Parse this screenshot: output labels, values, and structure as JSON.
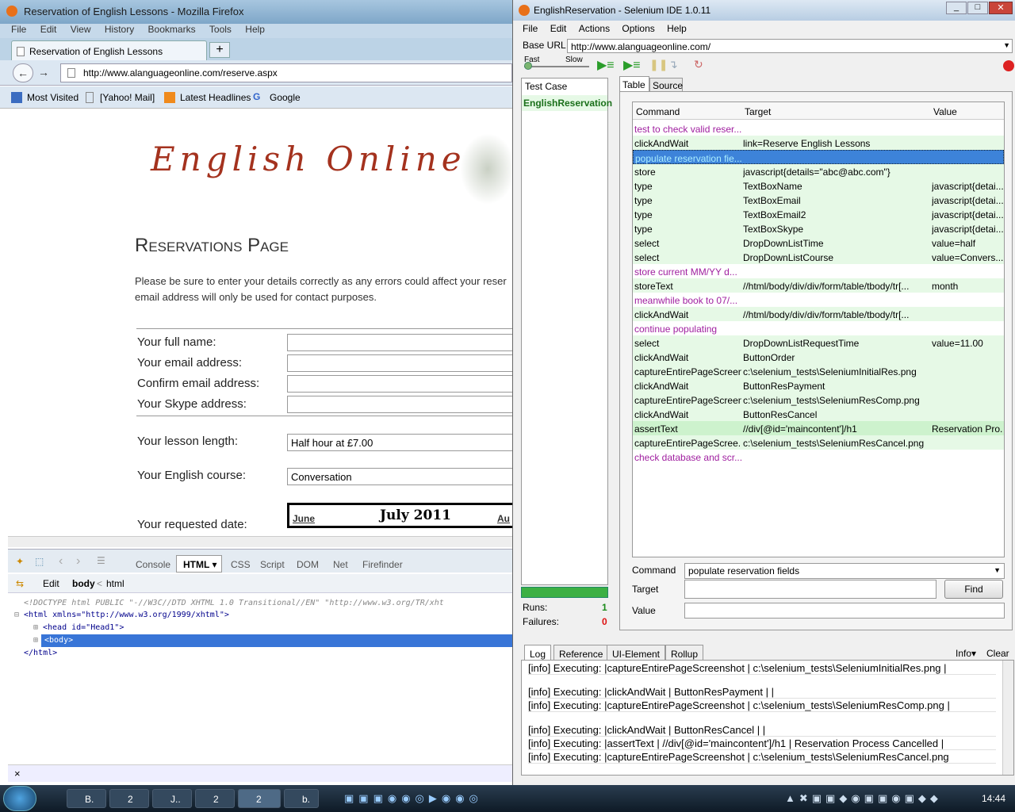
{
  "firefox": {
    "title": "Reservation of English Lessons - Mozilla Firefox",
    "menu": [
      "File",
      "Edit",
      "View",
      "History",
      "Bookmarks",
      "Tools",
      "Help"
    ],
    "tab": "Reservation of English Lessons",
    "url": "http://www.alanguageonline.com/reserve.aspx",
    "bookmarks": [
      "Most Visited",
      "[Yahoo! Mail]",
      "Latest Headlines",
      "Google"
    ],
    "page": {
      "logo": "English Online",
      "heading": "Reservations Page",
      "intro1": "Please be sure to enter your details correctly as any errors could affect your reser",
      "intro2": "email address will only be used for contact purposes.",
      "labels": [
        "Your full name:",
        "Your email address:",
        "Confirm email address:",
        "Your Skype address:",
        "Your lesson length:",
        "Your English course:",
        "Your requested date:"
      ],
      "lesson_length": "Half hour at £7.00",
      "course": "Conversation",
      "cal_prev": "June",
      "cal_month": "July 2011",
      "cal_next": "Au"
    },
    "firebug": {
      "tabs": [
        "Console",
        "HTML",
        "CSS",
        "Script",
        "DOM",
        "Net",
        "Firefinder"
      ],
      "edit": "Edit",
      "crumb_body": "body",
      "crumb_html": "html",
      "code": [
        "<!DOCTYPE html PUBLIC \"-//W3C//DTD XHTML 1.0 Transitional//EN\" \"http://www.w3.org/TR/xht",
        "<html xmlns=\"http://www.w3.org/1999/xhtml\">",
        "<head id=\"Head1\">",
        "<body>",
        "</html>"
      ]
    }
  },
  "selenium": {
    "title": "EnglishReservation - Selenium IDE 1.0.11",
    "menu": [
      "File",
      "Edit",
      "Actions",
      "Options",
      "Help"
    ],
    "base_url_label": "Base URL",
    "base_url": "http://www.alanguageonline.com/",
    "speed_fast": "Fast",
    "speed_slow": "Slow",
    "test_case_header": "Test Case",
    "test_case": "EnglishReservation",
    "tabs": [
      "Table",
      "Source"
    ],
    "columns": [
      "Command",
      "Target",
      "Value"
    ],
    "rows": [
      {
        "c": "test to check valid reser...",
        "t": "",
        "v": "",
        "kind": "comment"
      },
      {
        "c": "clickAndWait",
        "t": "link=Reserve English Lessons",
        "v": "",
        "kind": "green"
      },
      {
        "c": "populate reservation fie...",
        "t": "",
        "v": "",
        "kind": "selected"
      },
      {
        "c": "store",
        "t": "javascript{details=\"abc@abc.com\"}",
        "v": "",
        "kind": "green"
      },
      {
        "c": "type",
        "t": "TextBoxName",
        "v": "javascript{detai...",
        "kind": "green"
      },
      {
        "c": "type",
        "t": "TextBoxEmail",
        "v": "javascript{detai...",
        "kind": "green"
      },
      {
        "c": "type",
        "t": "TextBoxEmail2",
        "v": "javascript{detai...",
        "kind": "green"
      },
      {
        "c": "type",
        "t": "TextBoxSkype",
        "v": "javascript{detai...",
        "kind": "green"
      },
      {
        "c": "select",
        "t": "DropDownListTime",
        "v": "value=half",
        "kind": "green"
      },
      {
        "c": "select",
        "t": "DropDownListCourse",
        "v": "value=Convers...",
        "kind": "green"
      },
      {
        "c": "store current MM/YY d...",
        "t": "",
        "v": "",
        "kind": "comment"
      },
      {
        "c": "storeText",
        "t": "//html/body/div/div/form/table/tbody/tr[...",
        "v": "month",
        "kind": "green"
      },
      {
        "c": "meanwhile book to 07/...",
        "t": "",
        "v": "",
        "kind": "comment"
      },
      {
        "c": "clickAndWait",
        "t": "//html/body/div/div/form/table/tbody/tr[...",
        "v": "",
        "kind": "green"
      },
      {
        "c": "continue populating",
        "t": "",
        "v": "",
        "kind": "comment"
      },
      {
        "c": "select",
        "t": "DropDownListRequestTime",
        "v": "value=11.00",
        "kind": "green"
      },
      {
        "c": "clickAndWait",
        "t": "ButtonOrder",
        "v": "",
        "kind": "green"
      },
      {
        "c": "captureEntirePageScreen...",
        "t": "c:\\selenium_tests\\SeleniumInitialRes.png",
        "v": "",
        "kind": "green"
      },
      {
        "c": "clickAndWait",
        "t": "ButtonResPayment",
        "v": "",
        "kind": "green"
      },
      {
        "c": "captureEntirePageScreen...",
        "t": "c:\\selenium_tests\\SeleniumResComp.png",
        "v": "",
        "kind": "green"
      },
      {
        "c": "clickAndWait",
        "t": "ButtonResCancel",
        "v": "",
        "kind": "green"
      },
      {
        "c": "assertText",
        "t": "//div[@id='maincontent']/h1",
        "v": "Reservation Pro...",
        "kind": "greenstrong"
      },
      {
        "c": "captureEntirePageScree...",
        "t": "c:\\selenium_tests\\SeleniumResCancel.png",
        "v": "",
        "kind": "green"
      },
      {
        "c": "check database and scr...",
        "t": "",
        "v": "",
        "kind": "comment"
      }
    ],
    "editor": {
      "command_label": "Command",
      "command_value": "populate reservation fields",
      "target_label": "Target",
      "value_label": "Value",
      "find": "Find"
    },
    "runs_label": "Runs:",
    "runs": "1",
    "failures_label": "Failures:",
    "failures": "0",
    "log_tabs": [
      "Log",
      "Reference",
      "UI-Element",
      "Rollup"
    ],
    "info": "Info▾",
    "clear": "Clear",
    "log": [
      "[info] Executing: |captureEntirePageScreenshot | c:\\selenium_tests\\SeleniumInitialRes.png |",
      "[info] Executing: |clickAndWait | ButtonResPayment | |",
      "[info] Executing: |captureEntirePageScreenshot | c:\\selenium_tests\\SeleniumResComp.png |",
      "[info] Executing: |clickAndWait | ButtonResCancel | |",
      "[info] Executing: |assertText | //div[@id='maincontent']/h1 | Reservation Process Cancelled |",
      "[info] Executing: |captureEntirePageScreenshot | c:\\selenium_tests\\SeleniumResCancel.png"
    ]
  },
  "taskbar": {
    "items": [
      "B.",
      "2",
      "J..",
      "2",
      "2",
      "b."
    ],
    "clock": "14:44"
  }
}
